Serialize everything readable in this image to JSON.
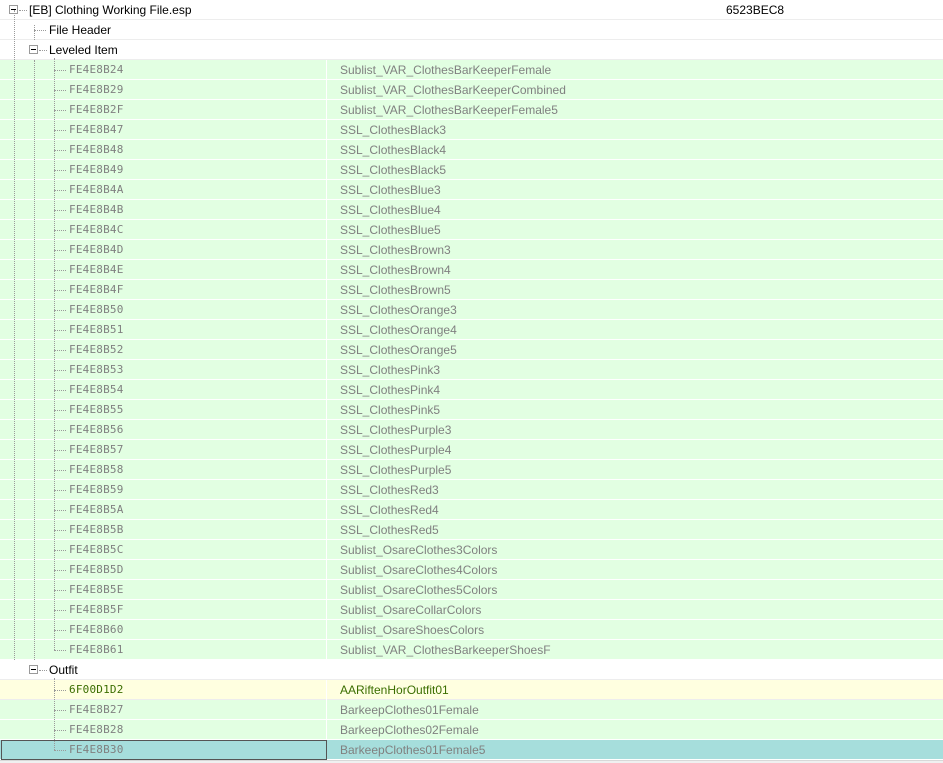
{
  "plugin": {
    "name": "[EB] Clothing Working File.esp",
    "crc": "6523BEC8"
  },
  "file_header": {
    "label": "File Header"
  },
  "leveled_item": {
    "label": "Leveled Item",
    "records": [
      {
        "formid": "FE4E8B24",
        "editor_id": "Sublist_VAR_ClothesBarKeeperFemale"
      },
      {
        "formid": "FE4E8B29",
        "editor_id": "Sublist_VAR_ClothesBarKeeperCombined"
      },
      {
        "formid": "FE4E8B2F",
        "editor_id": "Sublist_VAR_ClothesBarKeeperFemale5"
      },
      {
        "formid": "FE4E8B47",
        "editor_id": "SSL_ClothesBlack3"
      },
      {
        "formid": "FE4E8B48",
        "editor_id": "SSL_ClothesBlack4"
      },
      {
        "formid": "FE4E8B49",
        "editor_id": "SSL_ClothesBlack5"
      },
      {
        "formid": "FE4E8B4A",
        "editor_id": "SSL_ClothesBlue3"
      },
      {
        "formid": "FE4E8B4B",
        "editor_id": "SSL_ClothesBlue4"
      },
      {
        "formid": "FE4E8B4C",
        "editor_id": "SSL_ClothesBlue5"
      },
      {
        "formid": "FE4E8B4D",
        "editor_id": "SSL_ClothesBrown3"
      },
      {
        "formid": "FE4E8B4E",
        "editor_id": "SSL_ClothesBrown4"
      },
      {
        "formid": "FE4E8B4F",
        "editor_id": "SSL_ClothesBrown5"
      },
      {
        "formid": "FE4E8B50",
        "editor_id": "SSL_ClothesOrange3"
      },
      {
        "formid": "FE4E8B51",
        "editor_id": "SSL_ClothesOrange4"
      },
      {
        "formid": "FE4E8B52",
        "editor_id": "SSL_ClothesOrange5"
      },
      {
        "formid": "FE4E8B53",
        "editor_id": "SSL_ClothesPink3"
      },
      {
        "formid": "FE4E8B54",
        "editor_id": "SSL_ClothesPink4"
      },
      {
        "formid": "FE4E8B55",
        "editor_id": "SSL_ClothesPink5"
      },
      {
        "formid": "FE4E8B56",
        "editor_id": "SSL_ClothesPurple3"
      },
      {
        "formid": "FE4E8B57",
        "editor_id": "SSL_ClothesPurple4"
      },
      {
        "formid": "FE4E8B58",
        "editor_id": "SSL_ClothesPurple5"
      },
      {
        "formid": "FE4E8B59",
        "editor_id": "SSL_ClothesRed3"
      },
      {
        "formid": "FE4E8B5A",
        "editor_id": "SSL_ClothesRed4"
      },
      {
        "formid": "FE4E8B5B",
        "editor_id": "SSL_ClothesRed5"
      },
      {
        "formid": "FE4E8B5C",
        "editor_id": "Sublist_OsareClothes3Colors"
      },
      {
        "formid": "FE4E8B5D",
        "editor_id": "Sublist_OsareClothes4Colors"
      },
      {
        "formid": "FE4E8B5E",
        "editor_id": "Sublist_OsareClothes5Colors"
      },
      {
        "formid": "FE4E8B5F",
        "editor_id": "Sublist_OsareCollarColors"
      },
      {
        "formid": "FE4E8B60",
        "editor_id": "Sublist_OsareShoesColors"
      },
      {
        "formid": "FE4E8B61",
        "editor_id": "Sublist_VAR_ClothesBarkeeperShoesF"
      }
    ]
  },
  "outfit": {
    "label": "Outfit",
    "records": [
      {
        "formid": "6F00D1D2",
        "editor_id": "AARiftenHorOutfit01",
        "state": "override"
      },
      {
        "formid": "FE4E8B27",
        "editor_id": "BarkeepClothes01Female",
        "state": "new"
      },
      {
        "formid": "FE4E8B28",
        "editor_id": "BarkeepClothes02Female",
        "state": "new"
      },
      {
        "formid": "FE4E8B30",
        "editor_id": "BarkeepClothes01Female5",
        "state": "selected"
      }
    ]
  },
  "colors": {
    "new_record_bg": "#e2ffe2",
    "override_record_bg": "#ffffe0",
    "selected_bg": "#a6dedc",
    "dim_text": "#808080",
    "override_text": "#3b6e00"
  }
}
